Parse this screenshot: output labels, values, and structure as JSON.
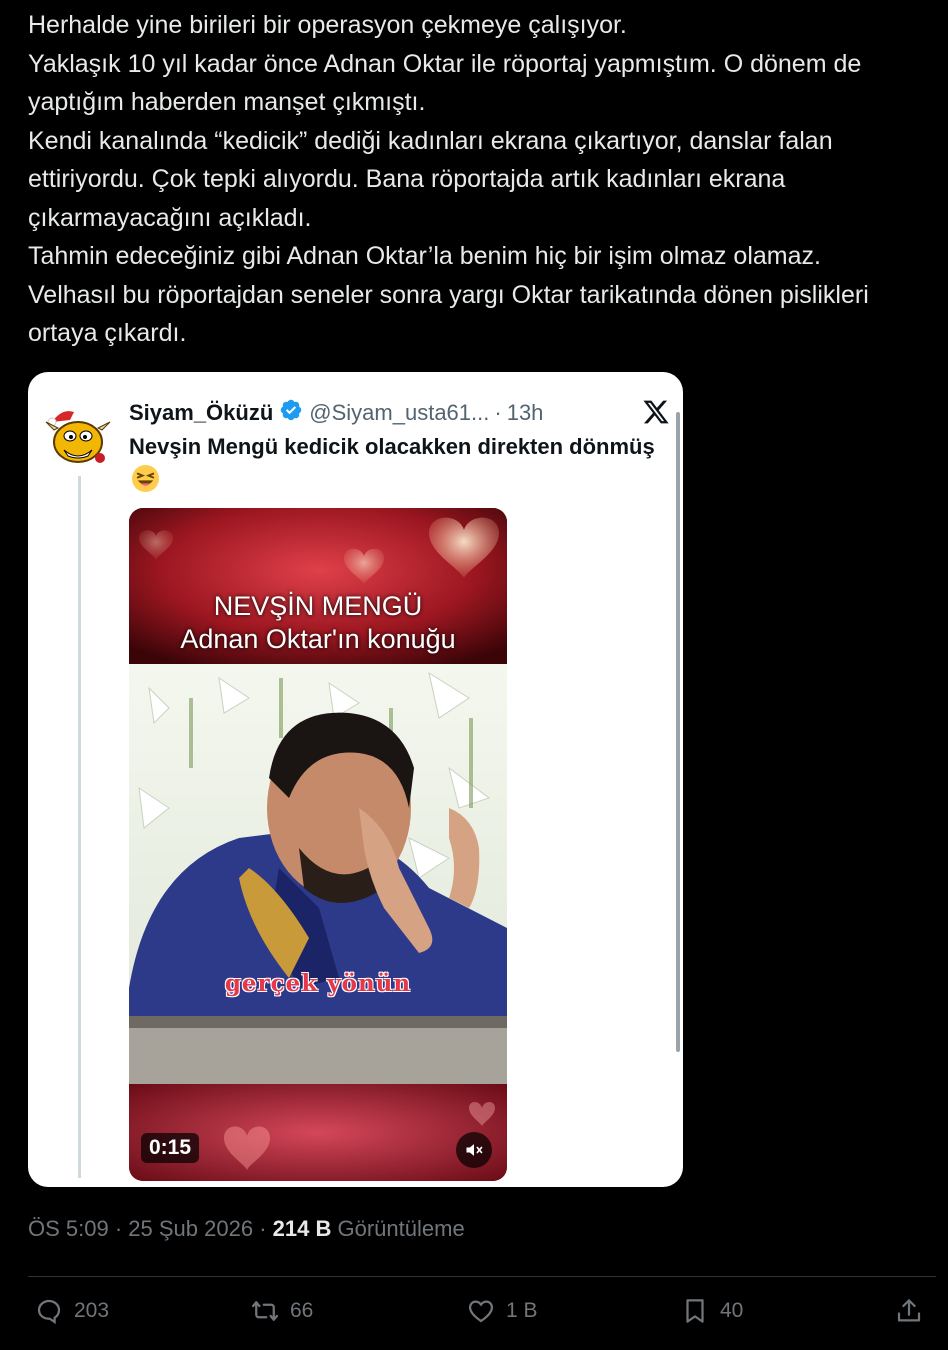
{
  "tweet": {
    "lines": [
      "Herhalde yine birileri bir operasyon çekmeye çalışıyor.",
      "Yaklaşık 10 yıl kadar önce Adnan Oktar ile röportaj yapmıştım. O dönem de yaptığım haberden manşet çıkmıştı.",
      "Kendi kanalında “kedicik” dediği kadınları ekrana çıkartıyor, danslar falan ettiriyordu. Çok tepki alıyordu. Bana röportajda artık kadınları ekrana çıkarmayacağını açıkladı.",
      "Tahmin edeceğiniz gibi Adnan Oktar’la benim hiç bir işim olmaz olamaz.",
      "Velhasıl bu röportajdan seneler sonra yargı Oktar tarikatında dönen pislikleri ortaya çıkardı."
    ]
  },
  "quote": {
    "name": "Siyam_Öküzü",
    "handle": "@Siyam_usta61...",
    "dot": "·",
    "time": "13h",
    "text": "Nevşin Mengü kedicik olacakken direkten dönmüş",
    "video": {
      "title_line1": "NEVŞİN MENGÜ",
      "title_line2": "Adnan Oktar'ın konuğu",
      "caption": "gerçek yönün",
      "duration": "0:15"
    }
  },
  "meta": {
    "time": "ÖS 5:09",
    "sep1": "·",
    "date": "25 Şub 2026",
    "sep2": "·",
    "views": "214 B",
    "views_label": "Görüntüleme"
  },
  "actions": {
    "replies": "203",
    "reposts": "66",
    "likes": "1 B",
    "bookmarks": "40"
  },
  "colors": {
    "background": "#000000",
    "text": "#e7e9ea",
    "muted": "#71767b",
    "verified": "#1d9bf0",
    "card": "#ffffff"
  },
  "icons": [
    "verified-badge-icon",
    "x-logo-icon",
    "laughing-emoji-icon",
    "mute-icon",
    "reply-icon",
    "repost-icon",
    "like-icon",
    "bookmark-icon",
    "share-icon"
  ]
}
